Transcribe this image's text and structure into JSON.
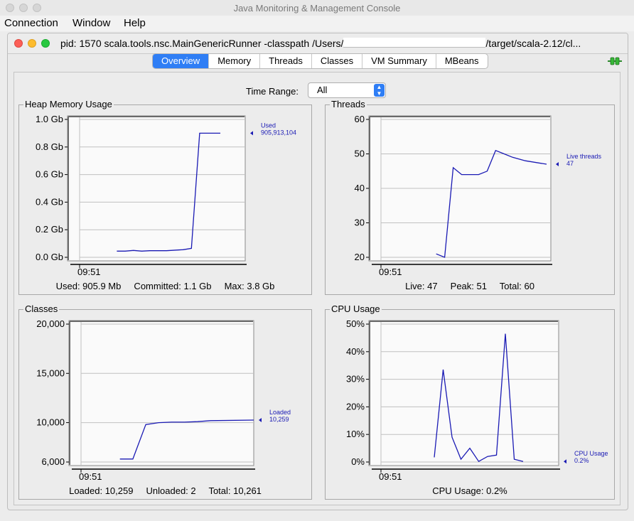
{
  "window": {
    "title": "Java Monitoring & Management Console"
  },
  "menu": [
    "Connection",
    "Window",
    "Help"
  ],
  "inner_window": {
    "title_prefix": "pid: 1570 scala.tools.nsc.MainGenericRunner -classpath /Users/",
    "title_suffix": "/target/scala-2.12/cl..."
  },
  "tabs": [
    {
      "label": "Overview",
      "active": true
    },
    {
      "label": "Memory"
    },
    {
      "label": "Threads"
    },
    {
      "label": "Classes"
    },
    {
      "label": "VM Summary"
    },
    {
      "label": "MBeans"
    }
  ],
  "time_range": {
    "label": "Time Range:",
    "value": "All"
  },
  "colors": {
    "accent": "#2f7ef5",
    "series": "#1a1ab4",
    "grid": "#c0c0c0"
  },
  "panels": {
    "heap": {
      "title": "Heap Memory Usage",
      "footer": "Used: 905.9 Mb     Committed: 1.1 Gb     Max: 3.8 Gb",
      "legend": [
        "Used",
        "905,913,104"
      ]
    },
    "threads": {
      "title": "Threads",
      "footer": "Live: 47     Peak: 51     Total: 60",
      "legend": [
        "Live threads",
        "47"
      ]
    },
    "classes": {
      "title": "Classes",
      "footer": "Loaded: 10,259     Unloaded: 2     Total: 10,261",
      "legend": [
        "Loaded",
        "10,259"
      ]
    },
    "cpu": {
      "title": "CPU Usage",
      "footer": "CPU Usage: 0.2%",
      "legend": [
        "CPU Usage",
        "0.2%"
      ]
    }
  },
  "chart_data": [
    {
      "type": "line",
      "title": "Heap Memory Usage",
      "x_tick_labels": [
        "09:51"
      ],
      "y_tick_labels": [
        "1.0 Gb",
        "0.8 Gb",
        "0.6 Gb",
        "0.4 Gb",
        "0.2 Gb",
        "0.0 Gb"
      ],
      "y_ticks": [
        1.0,
        0.8,
        0.6,
        0.4,
        0.2,
        0.0
      ],
      "ylim": [
        0,
        1.0
      ],
      "xlim": [
        0,
        20
      ],
      "series": [
        {
          "name": "Used",
          "values": [
            [
              4.5,
              0.045
            ],
            [
              5.5,
              0.045
            ],
            [
              6.5,
              0.05
            ],
            [
              7.5,
              0.045
            ],
            [
              8.5,
              0.048
            ],
            [
              10.5,
              0.048
            ],
            [
              12.5,
              0.055
            ],
            [
              13.5,
              0.065
            ],
            [
              14.5,
              0.9
            ],
            [
              17,
              0.9
            ]
          ]
        }
      ],
      "grid": true
    },
    {
      "type": "line",
      "title": "Threads",
      "x_tick_labels": [
        "09:51"
      ],
      "y_tick_labels": [
        "60",
        "50",
        "40",
        "30",
        "20"
      ],
      "y_ticks": [
        60,
        50,
        40,
        30,
        20
      ],
      "ylim": [
        20,
        60
      ],
      "xlim": [
        0,
        20
      ],
      "series": [
        {
          "name": "Live threads",
          "values": [
            [
              6.5,
              21
            ],
            [
              7.5,
              20
            ],
            [
              8.5,
              46
            ],
            [
              9.5,
              44
            ],
            [
              11.5,
              44
            ],
            [
              12.5,
              45
            ],
            [
              13.5,
              51
            ],
            [
              14.5,
              50
            ],
            [
              15.5,
              49
            ],
            [
              17,
              48
            ],
            [
              19.5,
              47
            ]
          ]
        }
      ],
      "grid": true
    },
    {
      "type": "line",
      "title": "Classes",
      "x_tick_labels": [
        "09:51"
      ],
      "y_tick_labels": [
        "20,000",
        "15,000",
        "10,000",
        "6,000"
      ],
      "y_ticks": [
        20000,
        15000,
        10000,
        6000
      ],
      "ylim": [
        6000,
        20000
      ],
      "xlim": [
        0,
        20
      ],
      "series": [
        {
          "name": "Loaded",
          "values": [
            [
              4.5,
              6300
            ],
            [
              6,
              6300
            ],
            [
              7.5,
              9800
            ],
            [
              9,
              10000
            ],
            [
              10.5,
              10050
            ],
            [
              12,
              10050
            ],
            [
              13.5,
              10100
            ],
            [
              15,
              10200
            ],
            [
              20,
              10259
            ]
          ]
        }
      ],
      "grid": true
    },
    {
      "type": "line",
      "title": "CPU Usage",
      "x_tick_labels": [
        "09:51"
      ],
      "y_tick_labels": [
        "50%",
        "40%",
        "30%",
        "20%",
        "10%",
        "0%"
      ],
      "y_ticks": [
        50,
        40,
        30,
        20,
        10,
        0
      ],
      "ylim": [
        0,
        50
      ],
      "xlim": [
        0,
        20
      ],
      "series": [
        {
          "name": "CPU Usage",
          "values": [
            [
              6,
              1.7
            ],
            [
              7,
              33.5
            ],
            [
              8,
              9
            ],
            [
              9,
              1
            ],
            [
              10,
              5
            ],
            [
              11,
              0.2
            ],
            [
              12,
              2
            ],
            [
              13,
              2.5
            ],
            [
              14,
              46.5
            ],
            [
              15,
              1
            ],
            [
              16,
              0.2
            ]
          ]
        }
      ],
      "grid": true
    }
  ]
}
